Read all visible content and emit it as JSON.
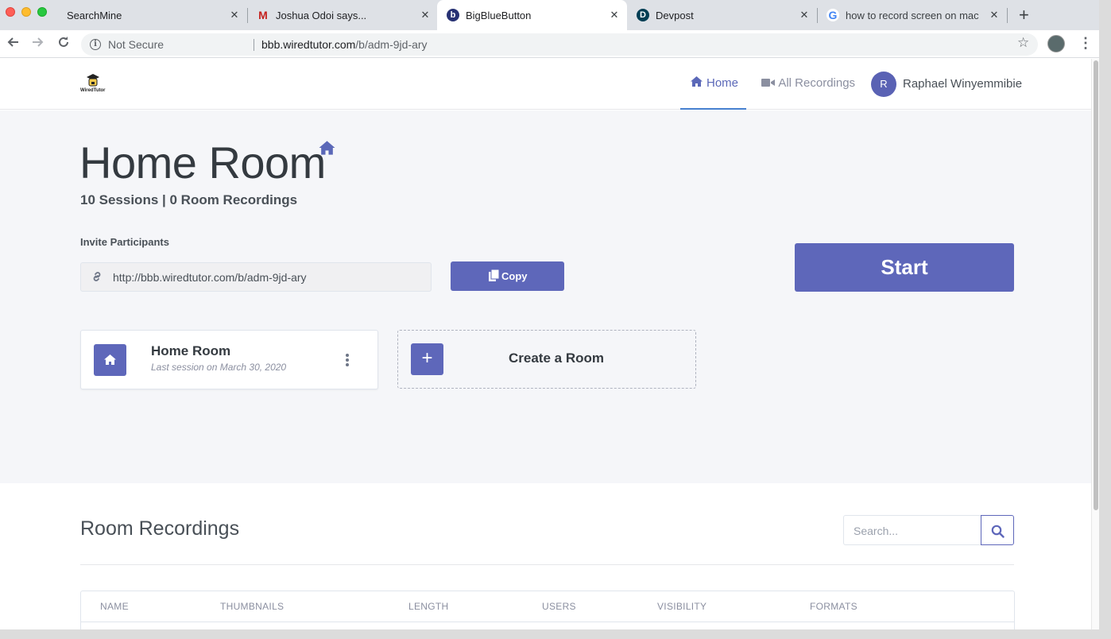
{
  "browser": {
    "tabs": [
      {
        "title": "SearchMine",
        "favicon": "blank",
        "active": false
      },
      {
        "title": "Joshua Odoi says...",
        "favicon": "gmail-icon",
        "active": false
      },
      {
        "title": "BigBlueButton",
        "favicon": "bigbluebutton-icon",
        "active": true
      },
      {
        "title": "Devpost",
        "favicon": "devpost-icon",
        "active": false
      },
      {
        "title": "how to record screen on mac -",
        "favicon": "google-icon",
        "active": false
      }
    ],
    "close_glyph": "✕",
    "new_tab_glyph": "+",
    "omnibox": {
      "security_label": "Not Secure",
      "url_host": "bbb.wiredtutor.com",
      "url_path": "/b/adm-9jd-ary"
    }
  },
  "navbar": {
    "logo_text": "WiredTutor",
    "home_label": "Home",
    "recordings_label": "All Recordings",
    "user_initial": "R",
    "user_name": "Raphael Winyemmibie"
  },
  "room": {
    "title": "Home Room",
    "stats": "10 Sessions | 0 Room Recordings",
    "invite_label": "Invite Participants",
    "invite_url": "http://bbb.wiredtutor.com/b/adm-9jd-ary",
    "copy_label": "Copy",
    "start_label": "Start"
  },
  "cards": {
    "room_name": "Home Room",
    "room_last_session": "Last session on March 30, 2020",
    "create_label": "Create a Room",
    "create_glyph": "+"
  },
  "recordings": {
    "title": "Room Recordings",
    "search_placeholder": "Search...",
    "columns": [
      "Name",
      "Thumbnails",
      "Length",
      "Users",
      "Visibility",
      "Formats"
    ]
  },
  "colors": {
    "accent": "#5e67ba",
    "hero_bg": "#f5f6f9"
  }
}
